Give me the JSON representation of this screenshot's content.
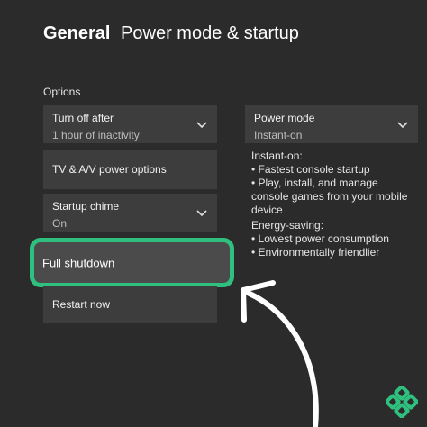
{
  "header": {
    "section": "General",
    "page": "Power mode & startup"
  },
  "options_label": "Options",
  "tiles": {
    "turn_off": {
      "title": "Turn off after",
      "value": "1 hour of inactivity"
    },
    "tv_av": {
      "title": "TV & A/V power options"
    },
    "chime": {
      "title": "Startup chime",
      "value": "On"
    },
    "full_shutdown": {
      "title": "Full shutdown"
    },
    "restart": {
      "title": "Restart now"
    },
    "power_mode": {
      "title": "Power mode",
      "value": "Instant-on"
    }
  },
  "info": {
    "instant": {
      "heading": "Instant-on:",
      "bullets": [
        "• Fastest console startup",
        "• Play, install, and manage console games from your mobile device"
      ]
    },
    "energy": {
      "heading": "Energy-saving:",
      "bullets": [
        "• Lowest power consumption",
        "• Environmentally friendlier"
      ]
    }
  },
  "colors": {
    "background": "#2b2b2b",
    "tile": "#3d3d3d",
    "highlight_border": "#2fbf7f",
    "arrow": "#ffffff"
  }
}
